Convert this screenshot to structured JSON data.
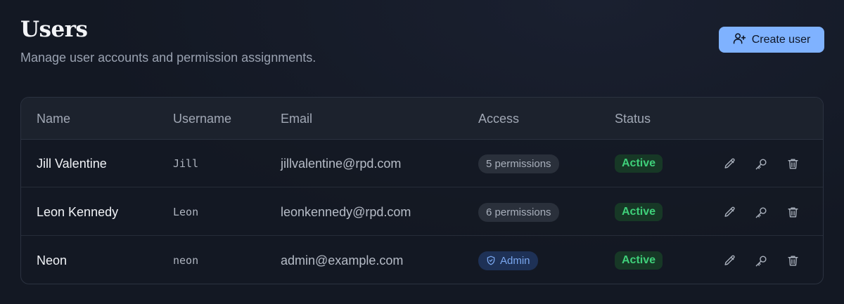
{
  "header": {
    "title": "Users",
    "subtitle": "Manage user accounts and permission assignments.",
    "create_label": "Create user"
  },
  "table": {
    "columns": [
      "Name",
      "Username",
      "Email",
      "Access",
      "Status"
    ],
    "rows": [
      {
        "name": "Jill Valentine",
        "username": "Jill",
        "email": "jillvalentine@rpd.com",
        "access": "5 permissions",
        "status": "Active"
      },
      {
        "name": "Leon Kennedy",
        "username": "Leon",
        "email": "leonkennedy@rpd.com",
        "access": "6 permissions",
        "status": "Active"
      },
      {
        "name": "Neon",
        "username": "neon",
        "email": "admin@example.com",
        "access": "Admin",
        "status": "Active"
      }
    ]
  },
  "icons": {
    "create": "user-plus-icon",
    "edit": "pencil-icon",
    "permissions": "key-icon",
    "delete": "trash-icon",
    "admin_badge": "shield-icon"
  },
  "colors": {
    "accent": "#7fb2ff",
    "active": "#3fd07a",
    "admin": "#7aa7ef"
  }
}
